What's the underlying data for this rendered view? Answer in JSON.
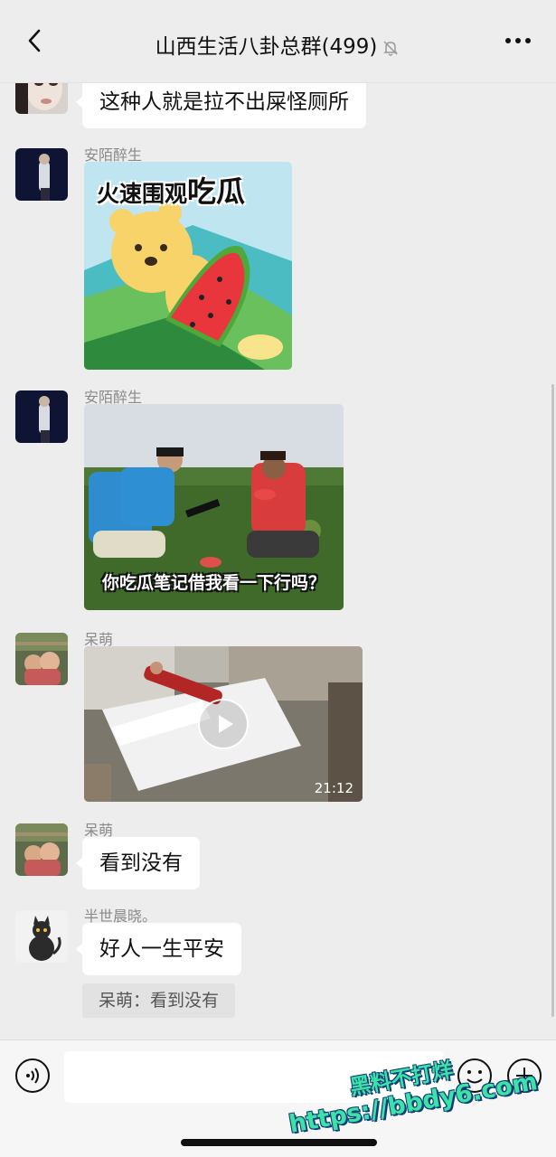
{
  "header": {
    "title": "山西生活八卦总群(499)"
  },
  "messages": [
    {
      "sender": "",
      "text": "这种人就是拉不出屎怪厕所"
    },
    {
      "sender": "安陌醉生",
      "sticker_text_1": "火速围观",
      "sticker_text_2": "吃瓜"
    },
    {
      "sender": "安陌醉生",
      "caption": "你吃瓜笔记借我看一下行吗？"
    },
    {
      "sender": "呆萌",
      "duration": "21:12"
    },
    {
      "sender": "呆萌",
      "text": "看到没有"
    },
    {
      "sender": "半世晨晓。",
      "text": "好人一生平安",
      "quote": "呆萌：看到没有"
    }
  ],
  "input": {
    "placeholder": ""
  },
  "watermark": {
    "line1": "黑料不打烊",
    "line2": "https://bbdy6.com"
  },
  "colors": {
    "background": "#ededed",
    "bubble": "#ffffff",
    "watermark": "#3de3a6"
  }
}
